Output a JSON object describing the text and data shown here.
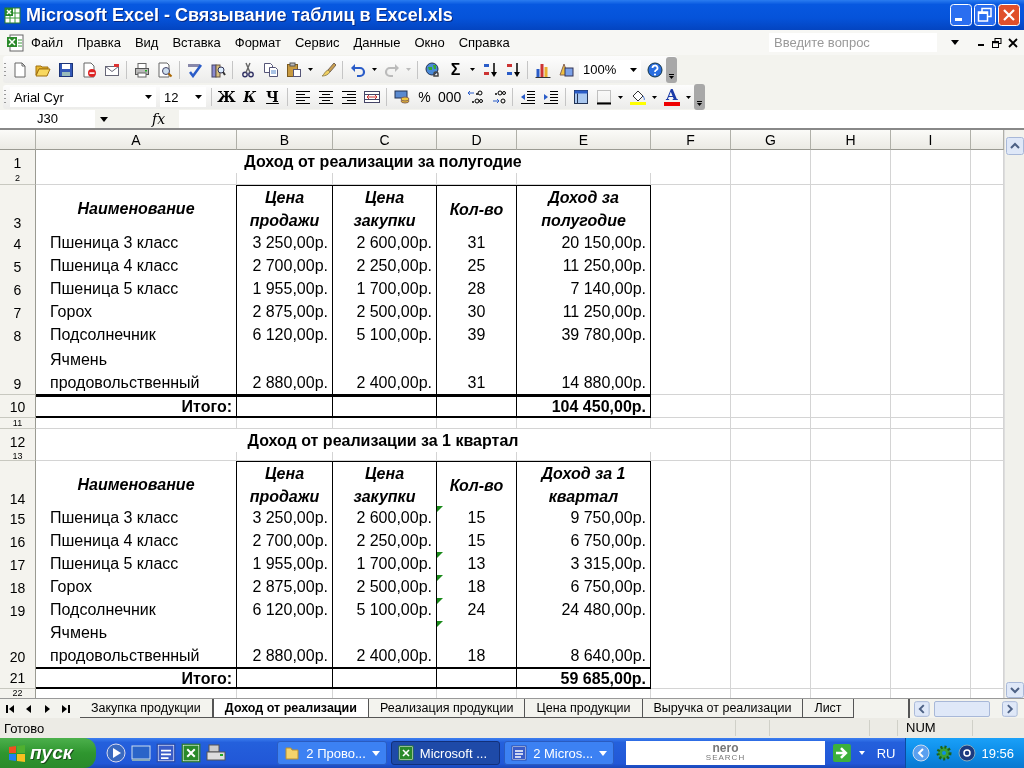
{
  "window": {
    "title": "Microsoft Excel - Связывание таблиц в Excel.xls"
  },
  "menu": {
    "items": [
      "Файл",
      "Правка",
      "Вид",
      "Вставка",
      "Формат",
      "Сервис",
      "Данные",
      "Окно",
      "Справка"
    ],
    "help_placeholder": "Введите вопрос"
  },
  "standard_toolbar": {
    "autosum": "Σ",
    "zoom": "100%"
  },
  "formatting_toolbar": {
    "font": "Arial Cyr",
    "size": "12",
    "bold": "Ж",
    "italic": "К",
    "underline": "Ч",
    "percent": "%",
    "thousands": "000",
    "font_color": "A"
  },
  "formula_bar": {
    "name_box": "J30",
    "function_label": "fx"
  },
  "sheet": {
    "columns": [
      "A",
      "B",
      "C",
      "D",
      "E",
      "F",
      "G",
      "H",
      "I"
    ],
    "rows": [
      {
        "number": "1",
        "kind": "title",
        "title": "Доход от реализации за полугодие"
      },
      {
        "number": "2",
        "kind": "spacer"
      },
      {
        "number": "3",
        "kind": "header",
        "cells": [
          "Наименование",
          "Цена продажи",
          "Цена закупки",
          "Кол-во",
          "Доход за полугодие"
        ]
      },
      {
        "number": "4",
        "kind": "data",
        "flagged": false,
        "cells": [
          "Пшеница 3 класс",
          "3 250,00р.",
          "2 600,00р.",
          "31",
          "20 150,00р."
        ]
      },
      {
        "number": "5",
        "kind": "data",
        "flagged": false,
        "cells": [
          "Пшеница 4 класс",
          "2 700,00р.",
          "2 250,00р.",
          "25",
          "11 250,00р."
        ]
      },
      {
        "number": "6",
        "kind": "data",
        "flagged": false,
        "cells": [
          "Пшеница 5 класс",
          "1 955,00р.",
          "1 700,00р.",
          "28",
          "7 140,00р."
        ]
      },
      {
        "number": "7",
        "kind": "data",
        "flagged": false,
        "cells": [
          "Горох",
          "2 875,00р.",
          "2 500,00р.",
          "30",
          "11 250,00р."
        ]
      },
      {
        "number": "8",
        "kind": "data",
        "flagged": false,
        "cells": [
          "Подсолнечник",
          "6 120,00р.",
          "5 100,00р.",
          "39",
          "39 780,00р."
        ]
      },
      {
        "number": "9",
        "kind": "data",
        "flagged": false,
        "cells": [
          "Ячмень продовольственный",
          "2 880,00р.",
          "2 400,00р.",
          "31",
          "14 880,00р."
        ]
      },
      {
        "number": "10",
        "kind": "total",
        "label": "Итого:",
        "total": "104 450,00р."
      },
      {
        "number": "11",
        "kind": "spacer"
      },
      {
        "number": "12",
        "kind": "title",
        "title": "Доход от реализации за 1 квартал"
      },
      {
        "number": "13",
        "kind": "spacer"
      },
      {
        "number": "14",
        "kind": "header",
        "cells": [
          "Наименование",
          "Цена продажи",
          "Цена закупки",
          "Кол-во",
          "Доход за 1 квартал"
        ]
      },
      {
        "number": "15",
        "kind": "data",
        "flagged": true,
        "cells": [
          "Пшеница 3 класс",
          "3 250,00р.",
          "2 600,00р.",
          "15",
          "9 750,00р."
        ]
      },
      {
        "number": "16",
        "kind": "data",
        "flagged": false,
        "cells": [
          "Пшеница 4 класс",
          "2 700,00р.",
          "2 250,00р.",
          "15",
          "6 750,00р."
        ]
      },
      {
        "number": "17",
        "kind": "data",
        "flagged": true,
        "cells": [
          "Пшеница 5 класс",
          "1 955,00р.",
          "1 700,00р.",
          "13",
          "3 315,00р."
        ]
      },
      {
        "number": "18",
        "kind": "data",
        "flagged": true,
        "cells": [
          "Горох",
          "2 875,00р.",
          "2 500,00р.",
          "18",
          "6 750,00р."
        ]
      },
      {
        "number": "19",
        "kind": "data",
        "flagged": true,
        "cells": [
          "Подсолнечник",
          "6 120,00р.",
          "5 100,00р.",
          "24",
          "24 480,00р."
        ]
      },
      {
        "number": "20",
        "kind": "data",
        "flagged": true,
        "cells": [
          "Ячмень продовольственный",
          "2 880,00р.",
          "2 400,00р.",
          "18",
          "8 640,00р."
        ]
      },
      {
        "number": "21",
        "kind": "total",
        "label": "Итого:",
        "total": "59 685,00р."
      },
      {
        "number": "22",
        "kind": "spacer"
      }
    ]
  },
  "sheet_tabs": {
    "tabs": [
      {
        "label": "Закупка продукции",
        "selected": false
      },
      {
        "label": "Доход от реализации",
        "selected": true
      },
      {
        "label": "Реализация продукции",
        "selected": false
      },
      {
        "label": "Цена продукции",
        "selected": false
      },
      {
        "label": "Выручка от реализации",
        "selected": false
      },
      {
        "label": "Лист",
        "selected": false
      }
    ]
  },
  "status_bar": {
    "status": "Готово",
    "indicator": "NUM"
  },
  "taskbar": {
    "start": "пуск",
    "tasks": [
      {
        "label": "2 Прово...",
        "kind": "folder",
        "selected": false,
        "grouped": true
      },
      {
        "label": "Microsoft ...",
        "kind": "excel",
        "selected": true,
        "grouped": false
      },
      {
        "label": "2 Micros...",
        "kind": "word",
        "selected": false,
        "grouped": true
      }
    ],
    "search_logo": {
      "name": "nero",
      "tagline": "SEARCH"
    },
    "language": "RU",
    "clock": "19:56"
  }
}
